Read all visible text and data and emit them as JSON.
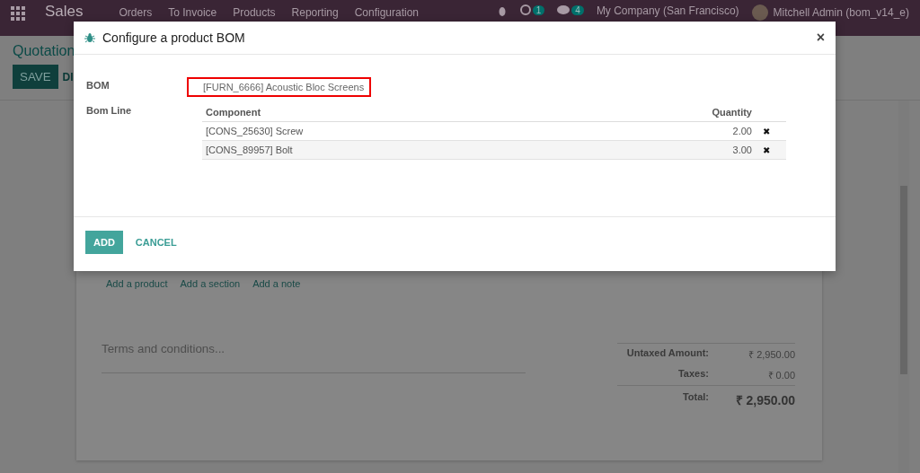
{
  "navbar": {
    "app": "Sales",
    "menu": [
      "Orders",
      "To Invoice",
      "Products",
      "Reporting",
      "Configuration"
    ],
    "activity_count": "1",
    "message_count": "4",
    "company": "My Company (San Francisco)",
    "user": "Mitchell Admin (bom_v14_e)"
  },
  "page": {
    "breadcrumb": "Quotation",
    "save": "SAVE",
    "discard": "DI",
    "line_links": [
      "Add a product",
      "Add a section",
      "Add a note"
    ],
    "terms_placeholder": "Terms and conditions...",
    "totals": [
      {
        "label": "Untaxed Amount:",
        "value": "₹ 2,950.00",
        "kind": "plain"
      },
      {
        "label": "Taxes:",
        "value": "₹ 0.00",
        "kind": "plain"
      },
      {
        "label": "Total:",
        "value": "₹ 2,950.00",
        "kind": "grand"
      }
    ]
  },
  "dialog": {
    "title": "Configure a product BOM",
    "close": "×",
    "bom_label": "BOM",
    "bom_value": "[FURN_6666] Acoustic Bloc Screens",
    "bom_line_label": "Bom Line",
    "columns": [
      "Component",
      "Quantity"
    ],
    "rows": [
      {
        "component": "[CONS_25630] Screw",
        "quantity": "2.00",
        "remove": "✖"
      },
      {
        "component": "[CONS_89957] Bolt",
        "quantity": "3.00",
        "remove": "✖"
      }
    ],
    "buttons": [
      {
        "label": "ADD",
        "kind": "primary"
      },
      {
        "label": "CANCEL",
        "kind": "link"
      }
    ]
  }
}
